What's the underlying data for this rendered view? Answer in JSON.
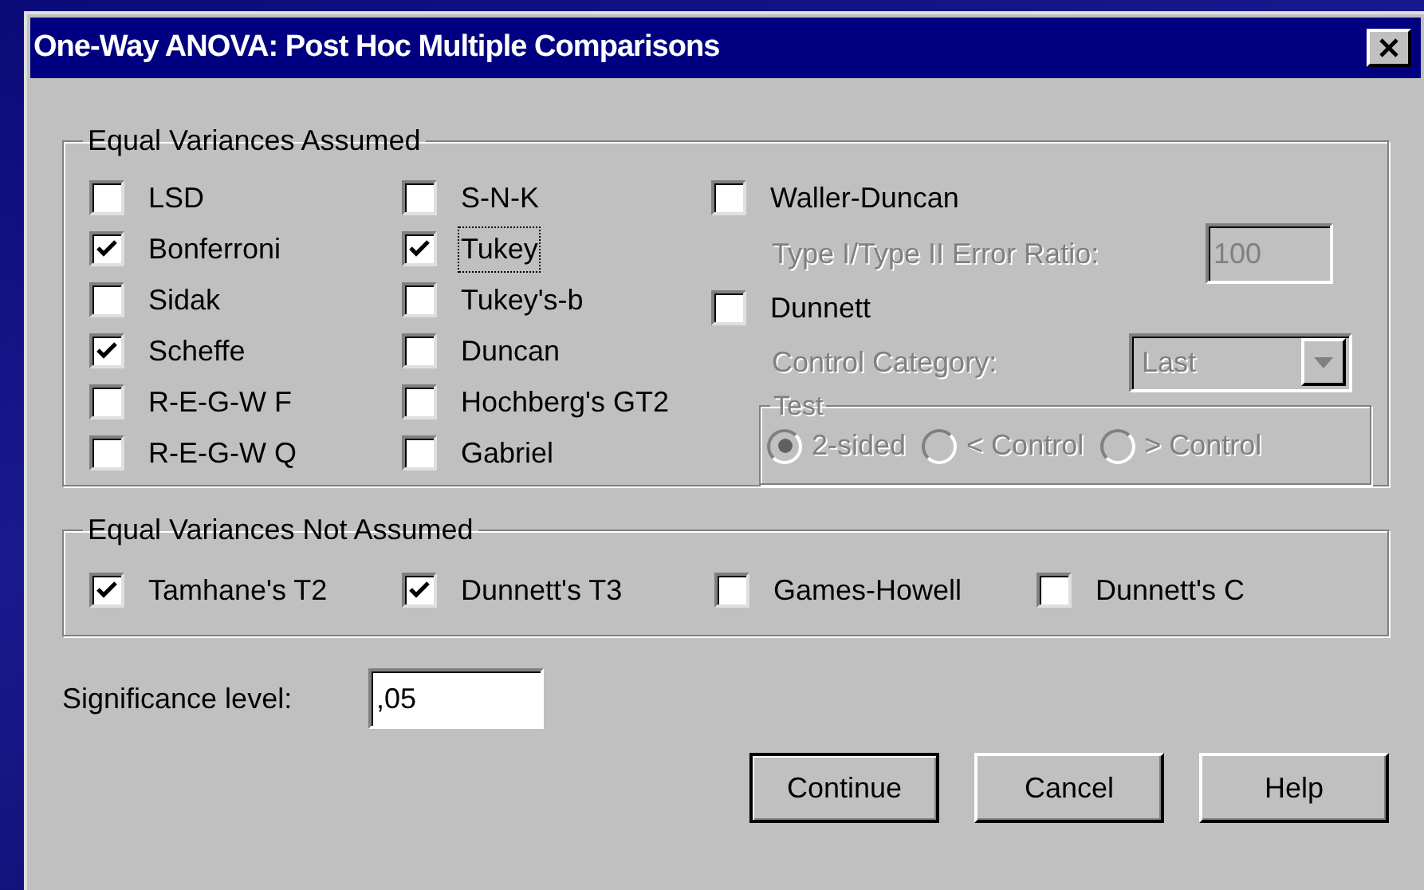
{
  "window": {
    "title": "One-Way ANOVA: Post Hoc Multiple Comparisons"
  },
  "equal_variances_assumed": {
    "legend": "Equal Variances Assumed",
    "columns": [
      [
        {
          "label": "LSD",
          "checked": false
        },
        {
          "label": "Bonferroni",
          "checked": true
        },
        {
          "label": "Sidak",
          "checked": false
        },
        {
          "label": "Scheffe",
          "checked": true
        },
        {
          "label": "R-E-G-W F",
          "checked": false
        },
        {
          "label": "R-E-G-W Q",
          "checked": false
        }
      ],
      [
        {
          "label": "S-N-K",
          "checked": false
        },
        {
          "label": "Tukey",
          "checked": true,
          "focused": true
        },
        {
          "label": "Tukey's-b",
          "checked": false
        },
        {
          "label": "Duncan",
          "checked": false
        },
        {
          "label": "Hochberg's GT2",
          "checked": false
        },
        {
          "label": "Gabriel",
          "checked": false
        }
      ]
    ],
    "waller_duncan": {
      "label": "Waller-Duncan",
      "checked": false,
      "ratio_label": "Type I/Type II Error Ratio:",
      "ratio_value": "100",
      "disabled": true
    },
    "dunnett": {
      "label": "Dunnett",
      "checked": false,
      "category_label": "Control Category:",
      "category_value": "Last",
      "disabled": true,
      "test": {
        "legend": "Test",
        "options": [
          {
            "label": "2-sided",
            "selected": true
          },
          {
            "label": "< Control",
            "selected": false
          },
          {
            "label": "> Control",
            "selected": false
          }
        ]
      }
    }
  },
  "equal_variances_not_assumed": {
    "legend": "Equal Variances Not Assumed",
    "options": [
      {
        "label": "Tamhane's T2",
        "checked": true
      },
      {
        "label": "Dunnett's T3",
        "checked": true
      },
      {
        "label": "Games-Howell",
        "checked": false
      },
      {
        "label": "Dunnett's C",
        "checked": false
      }
    ]
  },
  "significance": {
    "label": "Significance level:",
    "value": ",05"
  },
  "buttons": [
    {
      "label": "Continue",
      "default": true
    },
    {
      "label": "Cancel",
      "default": false
    },
    {
      "label": "Help",
      "default": false
    }
  ]
}
